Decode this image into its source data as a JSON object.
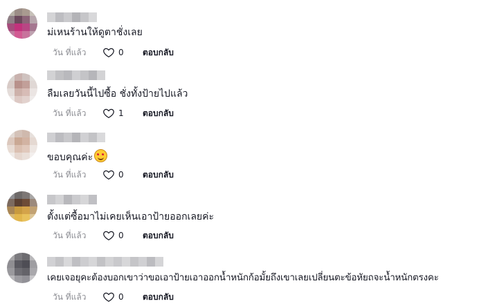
{
  "comments": [
    {
      "text": "ม่เหนร้านให้ดูตาชั่งเลย",
      "time": "วัน ที่แล้ว",
      "likes": "0",
      "reply": "ตอบกลับ",
      "has_emoji": false
    },
    {
      "text": "ลืมเลยวันนี้ไปซื้อ ชั่งทั้งป้ายไปแล้ว",
      "time": "วัน ที่แล้ว",
      "likes": "1",
      "reply": "ตอบกลับ",
      "has_emoji": false
    },
    {
      "text": "ขอบคุณค่ะ",
      "time": "วัน ที่แล้ว",
      "likes": "0",
      "reply": "ตอบกลับ",
      "has_emoji": true,
      "emoji": "smiling-face-with-hearts"
    },
    {
      "text": "ตั้งแต่ซื้อมาไม่เคยเห็นเอาป้ายออกเลยค่ะ",
      "time": "วัน ที่แล้ว",
      "likes": "0",
      "reply": "ตอบกลับ",
      "has_emoji": false
    },
    {
      "text": "เคยเจอยุคะต้องบอกเขาว่าขอเอาป้ายเอาออกน้ำหนักก้อมั้ยถึงเขาเลยเปลี่ยนตะข้อหัยถจะน้ำหนักตรงคะ",
      "time": "วัน ที่แล้ว",
      "likes": "0",
      "reply": "ตอบกลับ",
      "has_emoji": false
    }
  ],
  "icons": {
    "like": "heart-outline-icon"
  },
  "colors": {
    "text": "#161823",
    "muted": "#8a8b91",
    "background": "#ffffff"
  }
}
